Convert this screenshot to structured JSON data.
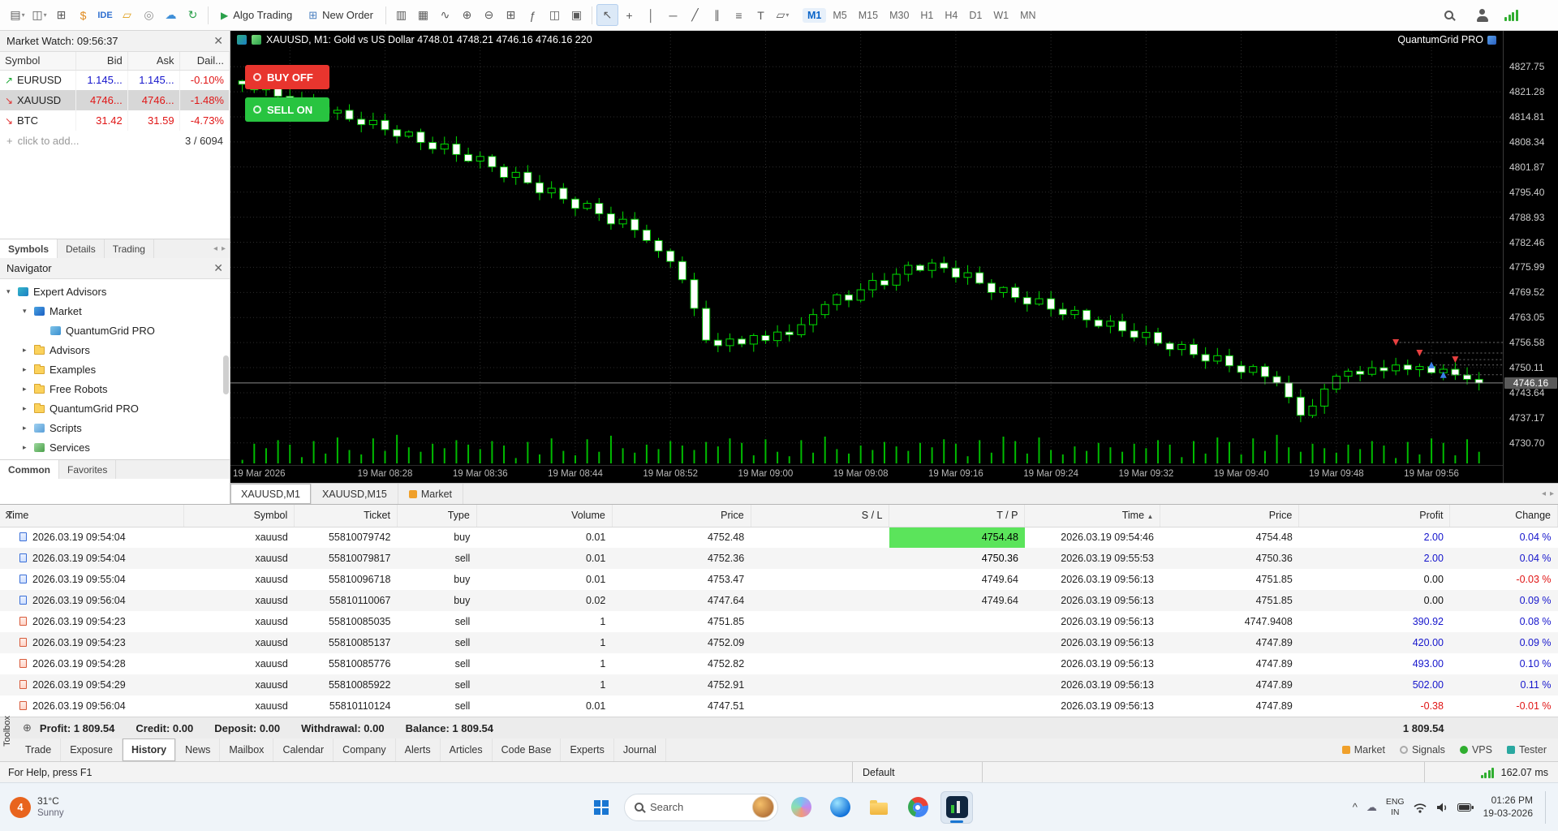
{
  "toolbar": {
    "icons_left": [
      {
        "name": "new-window-icon",
        "glyph": "▤",
        "suffix": "▾"
      },
      {
        "name": "profiles-icon",
        "glyph": "◫",
        "suffix": "▾"
      },
      {
        "name": "new-chart-icon",
        "glyph": "⊞"
      },
      {
        "name": "deposit-icon",
        "glyph": "$",
        "color": "#e08a1e"
      },
      {
        "name": "metaeditor-ide-icon",
        "glyph": "IDE",
        "color": "#2f6fd0",
        "small": true
      },
      {
        "name": "data-folder-icon",
        "glyph": "▱",
        "color": "#e0a01e"
      },
      {
        "name": "record-icon",
        "glyph": "◎",
        "color": "#909090"
      },
      {
        "name": "cloud-icon",
        "glyph": "☁",
        "color": "#3f8fd8"
      },
      {
        "name": "community-icon",
        "glyph": "↻",
        "color": "#2aa04a"
      }
    ],
    "algo_trading_label": "Algo Trading",
    "new_order_label": "New Order",
    "icons_mid": [
      {
        "name": "bars-style-icon",
        "glyph": "▥"
      },
      {
        "name": "candles-style-icon",
        "glyph": "▦"
      },
      {
        "name": "line-style-icon",
        "glyph": "∿"
      },
      {
        "name": "zoom-in-icon",
        "glyph": "⊕"
      },
      {
        "name": "zoom-out-icon",
        "glyph": "⊖"
      },
      {
        "name": "grid-icon",
        "glyph": "⊞"
      },
      {
        "name": "indicators-icon",
        "glyph": "ƒ"
      },
      {
        "name": "tile-windows-icon",
        "glyph": "◫"
      },
      {
        "name": "screenshot-icon",
        "glyph": "▣"
      },
      {
        "sep": true
      },
      {
        "name": "cursor-icon",
        "glyph": "↖",
        "active": true
      },
      {
        "name": "crosshair-icon",
        "glyph": "+"
      },
      {
        "name": "vertical-line-tool-icon",
        "glyph": "│"
      },
      {
        "name": "horizontal-line-tool-icon",
        "glyph": "─"
      },
      {
        "name": "trendline-tool-icon",
        "glyph": "╱"
      },
      {
        "name": "channel-tool-icon",
        "glyph": "∥"
      },
      {
        "name": "fibonacci-tool-icon",
        "glyph": "≡"
      },
      {
        "name": "text-tool-icon",
        "glyph": "T"
      },
      {
        "name": "shapes-tool-icon",
        "glyph": "▱",
        "suffix": "▾"
      }
    ],
    "timeframes": [
      {
        "label": "M1",
        "active": true
      },
      {
        "label": "M5"
      },
      {
        "label": "M15"
      },
      {
        "label": "M30"
      },
      {
        "label": "H1"
      },
      {
        "label": "H4"
      },
      {
        "label": "D1"
      },
      {
        "label": "W1"
      },
      {
        "label": "MN"
      }
    ]
  },
  "market_watch": {
    "title": "Market Watch: 09:56:37",
    "columns": [
      "Symbol",
      "Bid",
      "Ask",
      "Dail..."
    ],
    "rows": [
      {
        "dir": "up",
        "symbol": "EURUSD",
        "bid": "1.145...",
        "ask": "1.145...",
        "daily": "-0.10%",
        "bid_c": "blue",
        "ask_c": "blue",
        "daily_c": "red",
        "selected": false
      },
      {
        "dir": "down",
        "symbol": "XAUUSD",
        "bid": "4746...",
        "ask": "4746...",
        "daily": "-1.48%",
        "bid_c": "red",
        "ask_c": "red",
        "daily_c": "red",
        "selected": true
      },
      {
        "dir": "down",
        "symbol": "BTC",
        "bid": "31.42",
        "ask": "31.59",
        "daily": "-4.73%",
        "bid_c": "red",
        "ask_c": "red",
        "daily_c": "red",
        "selected": false
      }
    ],
    "add_label": "click to add...",
    "counter": "3 / 6094",
    "tabs": [
      {
        "label": "Symbols",
        "active": true
      },
      {
        "label": "Details"
      },
      {
        "label": "Trading"
      }
    ]
  },
  "navigator": {
    "title": "Navigator",
    "items": [
      {
        "indent": 0,
        "arrow": "▾",
        "icon": "ea",
        "label": "Expert Advisors"
      },
      {
        "indent": 1,
        "arrow": "▾",
        "icon": "market",
        "label": "Market"
      },
      {
        "indent": 2,
        "arrow": "",
        "icon": "leaf",
        "label": "QuantumGrid PRO"
      },
      {
        "indent": 1,
        "arrow": "▸",
        "icon": "folder",
        "label": "Advisors"
      },
      {
        "indent": 1,
        "arrow": "▸",
        "icon": "folder",
        "label": "Examples"
      },
      {
        "indent": 1,
        "arrow": "▸",
        "icon": "folder",
        "label": "Free Robots"
      },
      {
        "indent": 1,
        "arrow": "▸",
        "icon": "folder",
        "label": "QuantumGrid PRO"
      },
      {
        "indent": 1,
        "arrow": "▸",
        "icon": "scripts",
        "label": "Scripts"
      },
      {
        "indent": 1,
        "arrow": "▸",
        "icon": "services",
        "label": "Services"
      }
    ],
    "tabs": [
      {
        "label": "Common",
        "active": true
      },
      {
        "label": "Favorites"
      }
    ]
  },
  "chart": {
    "title": "XAUUSD, M1:  Gold vs US Dollar   4748.01 4748.21 4746.16 4746.16  220",
    "brand": "QuantumGrid PRO",
    "buy_button": "BUY OFF",
    "sell_button": "SELL ON",
    "current_price": "4746.16",
    "tabs": [
      {
        "label": "XAUUSD,M1",
        "active": true
      },
      {
        "label": "XAUUSD,M15"
      },
      {
        "label": "Market",
        "icon": "market-tab-icon"
      }
    ]
  },
  "chart_data": {
    "type": "candlestick",
    "symbol": "XAUUSD",
    "timeframe": "M1",
    "ylim": [
      4725,
      4837
    ],
    "price_labels": [
      "4827.75",
      "4821.28",
      "4814.81",
      "4808.34",
      "4801.87",
      "4795.40",
      "4788.93",
      "4782.46",
      "4775.99",
      "4769.52",
      "4763.05",
      "4756.58",
      "4750.11",
      "4743.64",
      "4737.17",
      "4730.70"
    ],
    "time_labels": [
      "19 Mar 2026",
      "19 Mar 08:28",
      "19 Mar 08:36",
      "19 Mar 08:44",
      "19 Mar 08:52",
      "19 Mar 09:00",
      "19 Mar 09:08",
      "19 Mar 09:16",
      "19 Mar 09:24",
      "19 Mar 09:32",
      "19 Mar 09:40",
      "19 Mar 09:48",
      "19 Mar 09:56"
    ],
    "bid": 4746.16,
    "closes": [
      4823.2,
      4821.8,
      4822.5,
      4820.1,
      4818.9,
      4819.6,
      4817.2,
      4815.8,
      4816.5,
      4814.2,
      4812.8,
      4813.9,
      4811.5,
      4809.8,
      4810.9,
      4808.2,
      4806.5,
      4807.8,
      4805.1,
      4803.4,
      4804.6,
      4801.9,
      4799.2,
      4800.5,
      4797.8,
      4795.2,
      4796.4,
      4793.6,
      4791.2,
      4792.5,
      4789.8,
      4787.2,
      4788.4,
      4785.6,
      4782.9,
      4780.2,
      4777.5,
      4772.8,
      4765.4,
      4757.2,
      4755.8,
      4757.5,
      4756.2,
      4758.4,
      4757.1,
      4759.3,
      4758.6,
      4761.2,
      4763.8,
      4766.4,
      4768.9,
      4767.5,
      4770.2,
      4772.6,
      4771.4,
      4774.2,
      4776.5,
      4775.2,
      4777.1,
      4775.8,
      4773.4,
      4774.6,
      4771.9,
      4769.5,
      4770.8,
      4768.2,
      4766.5,
      4767.9,
      4765.2,
      4763.8,
      4764.9,
      4762.4,
      4760.8,
      4762.1,
      4759.6,
      4757.9,
      4759.2,
      4756.4,
      4754.8,
      4756.1,
      4753.5,
      4751.8,
      4753.2,
      4750.6,
      4748.9,
      4750.4,
      4747.8,
      4746.2,
      4742.5,
      4737.8,
      4740.2,
      4744.6,
      4747.9,
      4749.2,
      4748.4,
      4750.1,
      4749.3,
      4750.8,
      4749.6,
      4750.4,
      4748.8,
      4749.7,
      4748.2,
      4747.1,
      4746.16
    ],
    "trade_markers": [
      {
        "type": "sell",
        "price": 4756.6,
        "offset": 7
      },
      {
        "type": "sell",
        "price": 4753.9,
        "offset": 5
      },
      {
        "type": "buy",
        "price": 4750.8,
        "offset": 4
      },
      {
        "type": "buy",
        "price": 4748.3,
        "offset": 3
      },
      {
        "type": "sell",
        "price": 4752.2,
        "offset": 2
      }
    ]
  },
  "history": {
    "columns": [
      {
        "label": "Time",
        "align": "left"
      },
      {
        "label": "Symbol"
      },
      {
        "label": "Ticket"
      },
      {
        "label": "Type"
      },
      {
        "label": "Volume"
      },
      {
        "label": "Price"
      },
      {
        "label": "S / L"
      },
      {
        "label": "T / P"
      },
      {
        "label": "Time",
        "sort": "asc"
      },
      {
        "label": "Price"
      },
      {
        "label": "Profit"
      },
      {
        "label": "Change"
      }
    ],
    "rows": [
      {
        "icon": "blue",
        "time": "2026.03.19 09:54:04",
        "symbol": "xauusd",
        "ticket": "55810079742",
        "type": "buy",
        "volume": "0.01",
        "price": "4752.48",
        "sl": "",
        "tp": "4754.48",
        "tp_highlight": true,
        "time2": "2026.03.19 09:54:46",
        "price2": "4754.48",
        "profit": "2.00",
        "profit_c": "blue",
        "change": "0.04 %",
        "change_c": "blue"
      },
      {
        "icon": "blue",
        "time": "2026.03.19 09:54:04",
        "symbol": "xauusd",
        "ticket": "55810079817",
        "type": "sell",
        "volume": "0.01",
        "price": "4752.36",
        "sl": "",
        "tp": "4750.36",
        "tp_highlight": true,
        "time2": "2026.03.19 09:55:53",
        "price2": "4750.36",
        "profit": "2.00",
        "profit_c": "blue",
        "change": "0.04 %",
        "change_c": "blue"
      },
      {
        "icon": "blue",
        "time": "2026.03.19 09:55:04",
        "symbol": "xauusd",
        "ticket": "55810096718",
        "type": "buy",
        "volume": "0.01",
        "price": "4753.47",
        "sl": "",
        "tp": "4749.64",
        "tp_highlight": false,
        "time2": "2026.03.19 09:56:13",
        "price2": "4751.85",
        "profit": "0.00",
        "profit_c": "black",
        "change": "-0.03 %",
        "change_c": "red"
      },
      {
        "icon": "blue",
        "time": "2026.03.19 09:56:04",
        "symbol": "xauusd",
        "ticket": "55810110067",
        "type": "buy",
        "volume": "0.02",
        "price": "4747.64",
        "sl": "",
        "tp": "4749.64",
        "tp_highlight": false,
        "time2": "2026.03.19 09:56:13",
        "price2": "4751.85",
        "profit": "0.00",
        "profit_c": "black",
        "change": "0.09 %",
        "change_c": "blue"
      },
      {
        "icon": "red",
        "time": "2026.03.19 09:54:23",
        "symbol": "xauusd",
        "ticket": "55810085035",
        "type": "sell",
        "volume": "1",
        "price": "4751.85",
        "sl": "",
        "tp": "",
        "tp_highlight": false,
        "time2": "2026.03.19 09:56:13",
        "price2": "4747.9408",
        "profit": "390.92",
        "profit_c": "blue",
        "change": "0.08 %",
        "change_c": "blue"
      },
      {
        "icon": "red",
        "time": "2026.03.19 09:54:23",
        "symbol": "xauusd",
        "ticket": "55810085137",
        "type": "sell",
        "volume": "1",
        "price": "4752.09",
        "sl": "",
        "tp": "",
        "tp_highlight": false,
        "time2": "2026.03.19 09:56:13",
        "price2": "4747.89",
        "profit": "420.00",
        "profit_c": "blue",
        "change": "0.09 %",
        "change_c": "blue"
      },
      {
        "icon": "red",
        "time": "2026.03.19 09:54:28",
        "symbol": "xauusd",
        "ticket": "55810085776",
        "type": "sell",
        "volume": "1",
        "price": "4752.82",
        "sl": "",
        "tp": "",
        "tp_highlight": false,
        "time2": "2026.03.19 09:56:13",
        "price2": "4747.89",
        "profit": "493.00",
        "profit_c": "blue",
        "change": "0.10 %",
        "change_c": "blue"
      },
      {
        "icon": "red",
        "time": "2026.03.19 09:54:29",
        "symbol": "xauusd",
        "ticket": "55810085922",
        "type": "sell",
        "volume": "1",
        "price": "4752.91",
        "sl": "",
        "tp": "",
        "tp_highlight": false,
        "time2": "2026.03.19 09:56:13",
        "price2": "4747.89",
        "profit": "502.00",
        "profit_c": "blue",
        "change": "0.11 %",
        "change_c": "blue"
      },
      {
        "icon": "red",
        "time": "2026.03.19 09:56:04",
        "symbol": "xauusd",
        "ticket": "55810110124",
        "type": "sell",
        "volume": "0.01",
        "price": "4747.51",
        "sl": "",
        "tp": "",
        "tp_highlight": false,
        "time2": "2026.03.19 09:56:13",
        "price2": "4747.89",
        "profit": "-0.38",
        "profit_c": "red",
        "change": "-0.01 %",
        "change_c": "red"
      }
    ],
    "summary": {
      "profit": "Profit: 1 809.54",
      "credit": "Credit: 0.00",
      "deposit": "Deposit: 0.00",
      "withdrawal": "Withdrawal: 0.00",
      "balance": "Balance: 1 809.54",
      "total": "1 809.54"
    }
  },
  "toolbox": {
    "label": "Toolbox",
    "tabs": [
      {
        "label": "Trade"
      },
      {
        "label": "Exposure"
      },
      {
        "label": "History",
        "active": true
      },
      {
        "label": "News"
      },
      {
        "label": "Mailbox"
      },
      {
        "label": "Calendar"
      },
      {
        "label": "Company"
      },
      {
        "label": "Alerts"
      },
      {
        "label": "Articles"
      },
      {
        "label": "Code Base"
      },
      {
        "label": "Experts"
      },
      {
        "label": "Journal"
      }
    ],
    "right": [
      {
        "label": "Market",
        "icon": "market-icon"
      },
      {
        "label": "Signals",
        "icon": "signals-icon"
      },
      {
        "label": "VPS",
        "icon": "vps-icon"
      },
      {
        "label": "Tester",
        "icon": "tester-icon"
      }
    ]
  },
  "status_bar": {
    "help": "For Help, press F1",
    "profile": "Default",
    "latency": "162.07 ms"
  },
  "taskbar": {
    "weather": {
      "badge": "4",
      "temp": "31°C",
      "desc": "Sunny"
    },
    "search_label": "Search",
    "tray": {
      "lang_top": "ENG",
      "lang_bottom": "IN",
      "time": "01:26 PM",
      "date": "19-03-2026"
    }
  }
}
